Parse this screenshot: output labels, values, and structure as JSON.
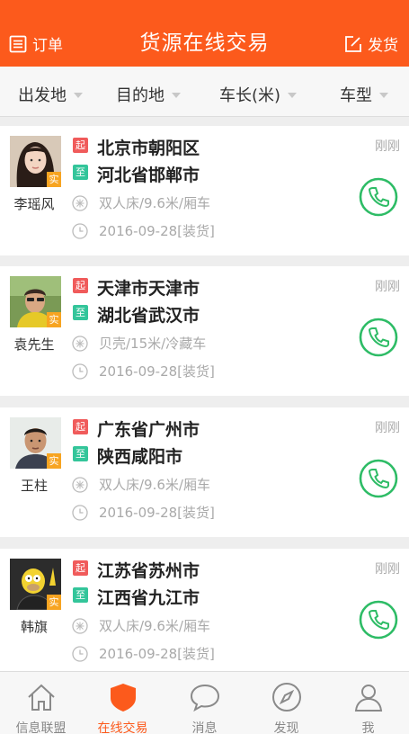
{
  "header": {
    "title": "货源在线交易",
    "left_label": "订单",
    "right_label": "发货",
    "bg_color": "#fc5a1c"
  },
  "filters": [
    {
      "label": "出发地"
    },
    {
      "label": "目的地"
    },
    {
      "label": "车长(米)"
    },
    {
      "label": "车型"
    }
  ],
  "tags": {
    "from": "起",
    "to": "至",
    "verified": "实"
  },
  "listings": [
    {
      "name": "李瑶风",
      "from": "北京市朝阳区",
      "to": "河北省邯郸市",
      "spec": "双人床/9.6米/厢车",
      "date": "2016-09-28[装货]",
      "time": "刚刚"
    },
    {
      "name": "袁先生",
      "from": "天津市天津市",
      "to": "湖北省武汉市",
      "spec": "贝壳/15米/冷藏车",
      "date": "2016-09-28[装货]",
      "time": "刚刚"
    },
    {
      "name": "王柱",
      "from": "广东省广州市",
      "to": "陕西咸阳市",
      "spec": "双人床/9.6米/厢车",
      "date": "2016-09-28[装货]",
      "time": "刚刚"
    },
    {
      "name": "韩旗",
      "from": "江苏省苏州市",
      "to": "江西省九江市",
      "spec": "双人床/9.6米/厢车",
      "date": "2016-09-28[装货]",
      "time": "刚刚"
    }
  ],
  "tabs": [
    {
      "label": "信息联盟",
      "icon": "home-icon"
    },
    {
      "label": "在线交易",
      "icon": "shield-icon",
      "active": true
    },
    {
      "label": "消息",
      "icon": "chat-bubble-icon"
    },
    {
      "label": "发现",
      "icon": "compass-icon"
    },
    {
      "label": "我",
      "icon": "user-icon"
    }
  ],
  "colors": {
    "accent": "#fc5a1c",
    "from_tag": "#f05b5b",
    "to_tag": "#33c59a",
    "verified": "#f7a421",
    "phone": "#2ebc66"
  }
}
